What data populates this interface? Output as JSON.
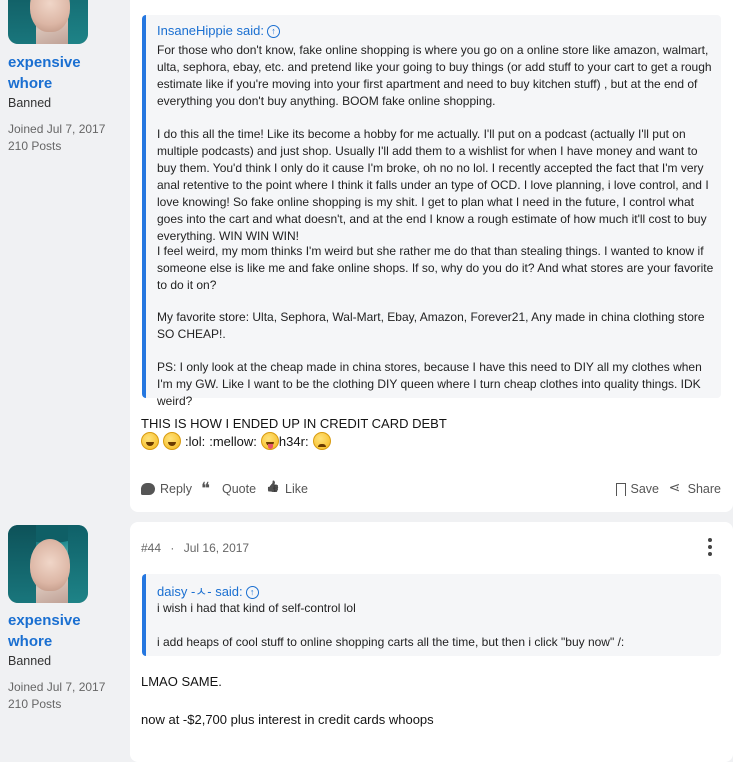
{
  "post1": {
    "user": {
      "name": "expensive whore",
      "title": "Banned",
      "joined": "Joined Jul 7, 2017",
      "posts": "210 Posts"
    },
    "quote": {
      "source": "InsaneHippie said:",
      "paragraphs": [
        "For those who don't know, fake online shopping is where you go on a online store like amazon, walmart, ulta, sephora, ebay, etc. and pretend like your going to buy things (or add stuff to your cart to get a rough estimate like if you're moving into your first apartment and need to buy kitchen stuff) , but at the end of everything you don't buy anything. BOOM fake online shopping.",
        "I do this all the time! Like its become a hobby for me actually. I'll put on a podcast (actually I'll put on multiple podcasts) and just shop. Usually I'll add them to a wishlist for when I have money and want to buy them. You'd think I only do it cause I'm broke, oh no no lol. I recently accepted the fact that I'm very anal retentive to the point where I think it falls under an type of OCD. I love planning, i love control, and I love knowing! So fake online shopping is my shit. I get to plan what I need in the future, I control what goes into the cart and what doesn't, and at the end I know a rough estimate of how much it'll cost to buy everything. WIN WIN WIN!",
        "I feel weird, my mom thinks I'm weird but she rather me do that than stealing things. I wanted to know if someone else is like me and fake online shops. If so, why do you do it? And what stores are your favorite to do it on?",
        "My favorite store: Ulta, Sephora, Wal-Mart, Ebay, Amazon, Forever21, Any made in china clothing store SO CHEAP!.",
        "PS: I only look at the cheap made in china stores, because I have this need to DIY all my clothes when I'm my GW. Like I want to be the clothing DIY queen where I turn cheap clothes into quality things. IDK weird?"
      ]
    },
    "body": "THIS IS HOW I ENDED UP IN CREDIT CARD DEBT",
    "emoji_text": {
      "lol": ":lol:",
      "mellow": ":mellow:",
      "h34r": "h34r:"
    },
    "actions": {
      "reply": "Reply",
      "quote": "Quote",
      "like": "Like",
      "save": "Save",
      "share": "Share"
    }
  },
  "post2": {
    "user": {
      "name": "expensive whore",
      "title": "Banned",
      "joined": "Joined Jul 7, 2017",
      "posts": "210 Posts"
    },
    "number": "#44",
    "separator": "·",
    "date": "Jul 16, 2017",
    "quote": {
      "source": "daisy -ㅅ- said:",
      "paragraphs": [
        "i wish i had that kind of self-control lol",
        "i add heaps of cool stuff to online shopping carts all the time, but then i click \"buy now\" /:"
      ]
    },
    "body": [
      "LMAO SAME.",
      "now at -$2,700 plus interest in credit cards whoops"
    ]
  }
}
